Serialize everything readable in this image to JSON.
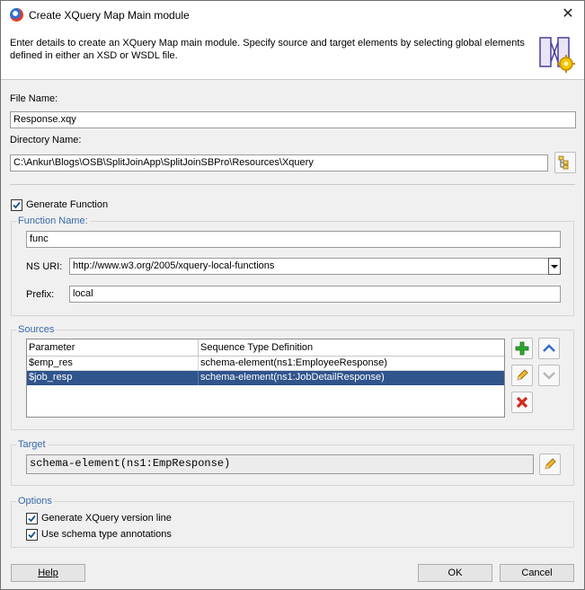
{
  "window": {
    "title": "Create XQuery Map Main module",
    "description": "Enter details to create an XQuery Map main module. Specify source and target elements by selecting global elements defined in either an XSD or WSDL file."
  },
  "file": {
    "file_name_label": "File Name:",
    "file_name_value": "Response.xqy",
    "directory_label": "Directory Name:",
    "directory_value": "C:\\Ankur\\Blogs\\OSB\\SplitJoinApp\\SplitJoinSBPro\\Resources\\Xquery"
  },
  "function": {
    "generate_label": "Generate Function",
    "generate_checked": true,
    "group_label": "Function Name:",
    "name_value": "func",
    "ns_uri_label": "NS URI:",
    "ns_uri_value": "http://www.w3.org/2005/xquery-local-functions",
    "prefix_label": "Prefix:",
    "prefix_value": "local"
  },
  "sources": {
    "group_label": "Sources",
    "columns": [
      "Parameter",
      "Sequence Type Definition"
    ],
    "rows": [
      {
        "parameter": "$emp_res",
        "definition": "schema-element(ns1:EmployeeResponse)",
        "selected": false
      },
      {
        "parameter": "$job_resp",
        "definition": "schema-element(ns1:JobDetailResponse)",
        "selected": true
      }
    ]
  },
  "target": {
    "group_label": "Target",
    "value": "schema-element(ns1:EmpResponse)"
  },
  "options": {
    "group_label": "Options",
    "version_line_label": "Generate XQuery version line",
    "version_line_checked": true,
    "schema_annotations_label": "Use schema type annotations",
    "schema_annotations_checked": true
  },
  "footer": {
    "help_label": "Help",
    "ok_label": "OK",
    "cancel_label": "Cancel"
  },
  "icons": {
    "close": "close-icon",
    "browse": "browse-folder-icon",
    "add": "add-plus-icon",
    "move_up": "move-up-icon",
    "edit": "edit-pencil-icon",
    "move_down": "move-down-icon",
    "delete": "delete-x-icon"
  },
  "colors": {
    "selection": "#30548c",
    "group_label": "#3a68a8",
    "add_green": "#2ea82e",
    "delete_red": "#d02a1e"
  }
}
